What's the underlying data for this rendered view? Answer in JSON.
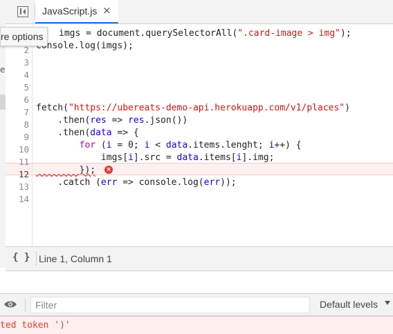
{
  "editor_tab": {
    "filename": "JavaScript.js",
    "close_glyph": "×"
  },
  "tooltip": {
    "text": "re options"
  },
  "navigator": {
    "fragment": "e"
  },
  "code": {
    "line_numbers": [
      "2",
      "3",
      "4",
      "5",
      "6",
      "7",
      "8",
      "9",
      "10",
      "11",
      "12",
      "13",
      "14"
    ],
    "lines": [
      "imgs = document.querySelectorAll(\".card-image > img\");",
      "console.log(imgs);",
      "",
      "",
      "",
      "fetch(\"https://ubereats-demo-api.herokuapp.com/v1/places\")",
      "    .then(res => res.json())",
      "    .then(data => {",
      "        for (i = 0; i < data.items.lenght; i++) {",
      "            imgs[i].src = data.items[i].img;",
      "        });",
      "    .catch (err => console.log(err));",
      ""
    ],
    "error_line": "12",
    "error_marker": "×"
  },
  "status_bar": {
    "braces": "{ }",
    "position": "Line 1, Column 1"
  },
  "console": {
    "filter_placeholder": "Filter",
    "levels_label": "Default levels",
    "error_message": "ted token ')'"
  },
  "colors": {
    "string": "#c41a16",
    "keyword": "#aa0d91",
    "variable": "#1c00cf",
    "error": "#e53935",
    "tab_accent": "#1a73e8"
  },
  "icons": {
    "sidebar_toggle": "sidebar-toggle-icon",
    "format": "braces-icon",
    "eye": "eye-icon",
    "error": "error-icon",
    "dropdown": "chevron-down-icon"
  }
}
